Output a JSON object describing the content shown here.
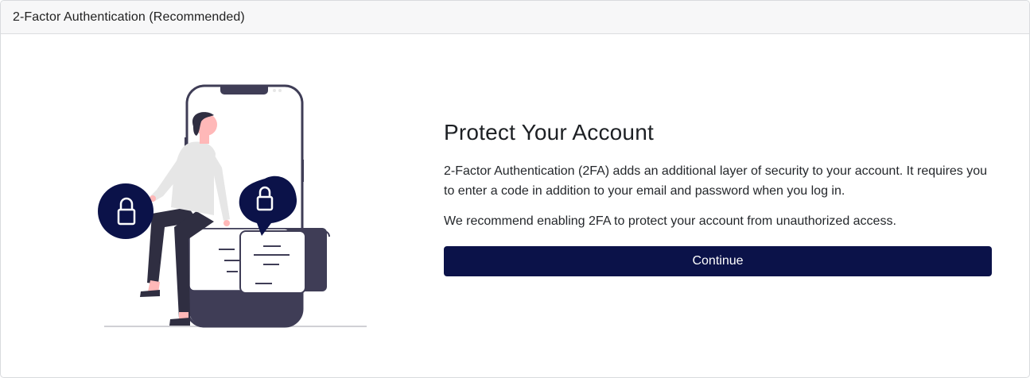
{
  "header": {
    "title": "2-Factor Authentication (Recommended)"
  },
  "main": {
    "heading": "Protect Your Account",
    "paragraph1": "2-Factor Authentication (2FA) adds an additional layer of security to your account. It requires you to enter a code in addition to your email and password when you log in.",
    "paragraph2": "We recommend enabling 2FA to protect your account from unauthorized access.",
    "continue_label": "Continue"
  },
  "illustration": {
    "icons": [
      "phone-icon",
      "lock-icon",
      "message-icon"
    ]
  },
  "colors": {
    "accent": "#0b1249",
    "illustration_dark": "#3f3d56",
    "skin": "#ffb8b8"
  }
}
